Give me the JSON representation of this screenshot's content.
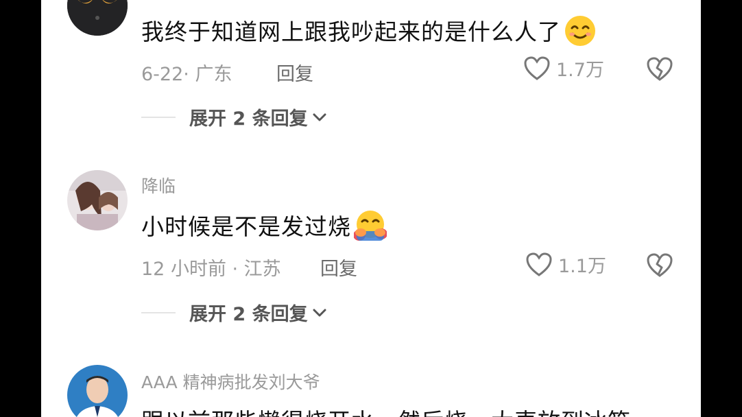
{
  "comments": [
    {
      "username": "",
      "text": "我终于知道网上跟我吵起来的是什么人了",
      "emoji": "smiling-face-emoji",
      "date_location": "6-22· 广东",
      "reply_label": "回复",
      "likes": "1.7万",
      "expand_label": "展开 2 条回复"
    },
    {
      "username": "降临",
      "text": "小时候是不是发过烧",
      "emoji": "hugging-face-emoji",
      "date_location": "12 小时前 · 江苏",
      "reply_label": "回复",
      "likes": "1.1万",
      "expand_label": "展开 2 条回复"
    },
    {
      "username": "AAA 精神病批发刘大爷",
      "text": "跟以前那些懒得烧开水，然后烧一大壶放到冰箱"
    }
  ],
  "colors": {
    "background": "#000000",
    "panel": "#ffffff",
    "muted_text": "#9a9a9a",
    "main_text": "#111111"
  }
}
